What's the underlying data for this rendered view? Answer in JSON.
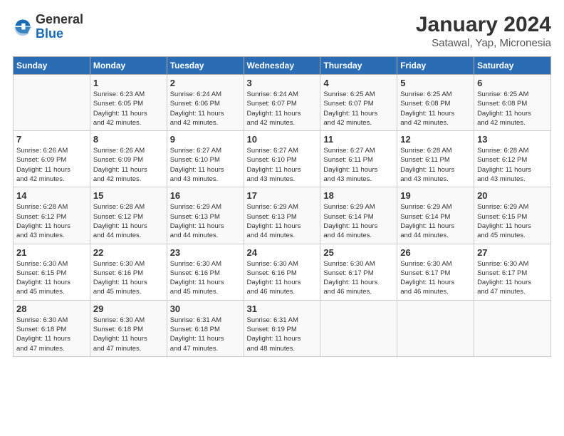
{
  "logo": {
    "general": "General",
    "blue": "Blue"
  },
  "title": "January 2024",
  "subtitle": "Satawal, Yap, Micronesia",
  "headers": [
    "Sunday",
    "Monday",
    "Tuesday",
    "Wednesday",
    "Thursday",
    "Friday",
    "Saturday"
  ],
  "weeks": [
    [
      {
        "day": "",
        "lines": []
      },
      {
        "day": "1",
        "lines": [
          "Sunrise: 6:23 AM",
          "Sunset: 6:05 PM",
          "Daylight: 11 hours",
          "and 42 minutes."
        ]
      },
      {
        "day": "2",
        "lines": [
          "Sunrise: 6:24 AM",
          "Sunset: 6:06 PM",
          "Daylight: 11 hours",
          "and 42 minutes."
        ]
      },
      {
        "day": "3",
        "lines": [
          "Sunrise: 6:24 AM",
          "Sunset: 6:07 PM",
          "Daylight: 11 hours",
          "and 42 minutes."
        ]
      },
      {
        "day": "4",
        "lines": [
          "Sunrise: 6:25 AM",
          "Sunset: 6:07 PM",
          "Daylight: 11 hours",
          "and 42 minutes."
        ]
      },
      {
        "day": "5",
        "lines": [
          "Sunrise: 6:25 AM",
          "Sunset: 6:08 PM",
          "Daylight: 11 hours",
          "and 42 minutes."
        ]
      },
      {
        "day": "6",
        "lines": [
          "Sunrise: 6:25 AM",
          "Sunset: 6:08 PM",
          "Daylight: 11 hours",
          "and 42 minutes."
        ]
      }
    ],
    [
      {
        "day": "7",
        "lines": [
          "Sunrise: 6:26 AM",
          "Sunset: 6:09 PM",
          "Daylight: 11 hours",
          "and 42 minutes."
        ]
      },
      {
        "day": "8",
        "lines": [
          "Sunrise: 6:26 AM",
          "Sunset: 6:09 PM",
          "Daylight: 11 hours",
          "and 42 minutes."
        ]
      },
      {
        "day": "9",
        "lines": [
          "Sunrise: 6:27 AM",
          "Sunset: 6:10 PM",
          "Daylight: 11 hours",
          "and 43 minutes."
        ]
      },
      {
        "day": "10",
        "lines": [
          "Sunrise: 6:27 AM",
          "Sunset: 6:10 PM",
          "Daylight: 11 hours",
          "and 43 minutes."
        ]
      },
      {
        "day": "11",
        "lines": [
          "Sunrise: 6:27 AM",
          "Sunset: 6:11 PM",
          "Daylight: 11 hours",
          "and 43 minutes."
        ]
      },
      {
        "day": "12",
        "lines": [
          "Sunrise: 6:28 AM",
          "Sunset: 6:11 PM",
          "Daylight: 11 hours",
          "and 43 minutes."
        ]
      },
      {
        "day": "13",
        "lines": [
          "Sunrise: 6:28 AM",
          "Sunset: 6:12 PM",
          "Daylight: 11 hours",
          "and 43 minutes."
        ]
      }
    ],
    [
      {
        "day": "14",
        "lines": [
          "Sunrise: 6:28 AM",
          "Sunset: 6:12 PM",
          "Daylight: 11 hours",
          "and 43 minutes."
        ]
      },
      {
        "day": "15",
        "lines": [
          "Sunrise: 6:28 AM",
          "Sunset: 6:12 PM",
          "Daylight: 11 hours",
          "and 44 minutes."
        ]
      },
      {
        "day": "16",
        "lines": [
          "Sunrise: 6:29 AM",
          "Sunset: 6:13 PM",
          "Daylight: 11 hours",
          "and 44 minutes."
        ]
      },
      {
        "day": "17",
        "lines": [
          "Sunrise: 6:29 AM",
          "Sunset: 6:13 PM",
          "Daylight: 11 hours",
          "and 44 minutes."
        ]
      },
      {
        "day": "18",
        "lines": [
          "Sunrise: 6:29 AM",
          "Sunset: 6:14 PM",
          "Daylight: 11 hours",
          "and 44 minutes."
        ]
      },
      {
        "day": "19",
        "lines": [
          "Sunrise: 6:29 AM",
          "Sunset: 6:14 PM",
          "Daylight: 11 hours",
          "and 44 minutes."
        ]
      },
      {
        "day": "20",
        "lines": [
          "Sunrise: 6:29 AM",
          "Sunset: 6:15 PM",
          "Daylight: 11 hours",
          "and 45 minutes."
        ]
      }
    ],
    [
      {
        "day": "21",
        "lines": [
          "Sunrise: 6:30 AM",
          "Sunset: 6:15 PM",
          "Daylight: 11 hours",
          "and 45 minutes."
        ]
      },
      {
        "day": "22",
        "lines": [
          "Sunrise: 6:30 AM",
          "Sunset: 6:16 PM",
          "Daylight: 11 hours",
          "and 45 minutes."
        ]
      },
      {
        "day": "23",
        "lines": [
          "Sunrise: 6:30 AM",
          "Sunset: 6:16 PM",
          "Daylight: 11 hours",
          "and 45 minutes."
        ]
      },
      {
        "day": "24",
        "lines": [
          "Sunrise: 6:30 AM",
          "Sunset: 6:16 PM",
          "Daylight: 11 hours",
          "and 46 minutes."
        ]
      },
      {
        "day": "25",
        "lines": [
          "Sunrise: 6:30 AM",
          "Sunset: 6:17 PM",
          "Daylight: 11 hours",
          "and 46 minutes."
        ]
      },
      {
        "day": "26",
        "lines": [
          "Sunrise: 6:30 AM",
          "Sunset: 6:17 PM",
          "Daylight: 11 hours",
          "and 46 minutes."
        ]
      },
      {
        "day": "27",
        "lines": [
          "Sunrise: 6:30 AM",
          "Sunset: 6:17 PM",
          "Daylight: 11 hours",
          "and 47 minutes."
        ]
      }
    ],
    [
      {
        "day": "28",
        "lines": [
          "Sunrise: 6:30 AM",
          "Sunset: 6:18 PM",
          "Daylight: 11 hours",
          "and 47 minutes."
        ]
      },
      {
        "day": "29",
        "lines": [
          "Sunrise: 6:30 AM",
          "Sunset: 6:18 PM",
          "Daylight: 11 hours",
          "and 47 minutes."
        ]
      },
      {
        "day": "30",
        "lines": [
          "Sunrise: 6:31 AM",
          "Sunset: 6:18 PM",
          "Daylight: 11 hours",
          "and 47 minutes."
        ]
      },
      {
        "day": "31",
        "lines": [
          "Sunrise: 6:31 AM",
          "Sunset: 6:19 PM",
          "Daylight: 11 hours",
          "and 48 minutes."
        ]
      },
      {
        "day": "",
        "lines": []
      },
      {
        "day": "",
        "lines": []
      },
      {
        "day": "",
        "lines": []
      }
    ]
  ]
}
